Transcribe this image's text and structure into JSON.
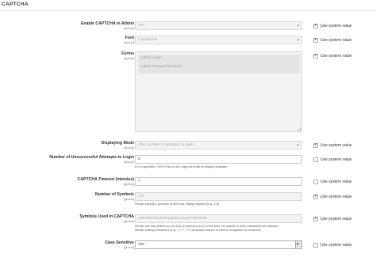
{
  "section": {
    "title": "CAPTCHA"
  },
  "fields": {
    "enable_admin": {
      "label": "Enable CAPTCHA in Admin",
      "scope": "[global]",
      "value": "Yes",
      "use_system": true
    },
    "font": {
      "label": "Font",
      "scope": "[global]",
      "value": "LinLibertine",
      "use_system": true
    },
    "forms": {
      "label": "Forms",
      "scope": "[global]",
      "options": [
        "Admin Login",
        "Admin Forgot Password"
      ],
      "use_system": true
    },
    "displaying_mode": {
      "label": "Displaying Mode",
      "scope": "[global]",
      "value": "After number of attempts to login",
      "use_system": true
    },
    "attempts": {
      "label": "Number of Unsuccessful Attempts to Login",
      "scope": "[global]",
      "value": "0",
      "note": "If 0 is specified, CAPTCHA on the Login form will be always available.",
      "use_system": false
    },
    "timeout": {
      "label": "CAPTCHA Timeout (minutes)",
      "scope": "[global]",
      "value": "7",
      "use_system": false
    },
    "symbols_count": {
      "label": "Number of Symbols",
      "scope": "[global]",
      "value": "4-5",
      "note": "Please specify 8 symbols at the most. Range allowed (e.g. 3-5)",
      "use_system": true
    },
    "symbols_used": {
      "label": "Symbols Used in CAPTCHA",
      "scope": "[global]",
      "value": "ABCDEFGHJKMnpqrstuvwxyz23456789",
      "note_1": "Please use only letters (a-z or A-Z) or numbers (0-9) in this field. No spaces or other characters are allowed.",
      "note_2": "Similar looking characters (e.g. \"i\", \"l\", \"1\") decrease chance of correct recognition by customer.",
      "use_system": true
    },
    "case_sensitive": {
      "label": "Case Sensitive",
      "scope": "[global]",
      "value": "Yes",
      "use_system": false
    }
  },
  "common": {
    "use_system_label": "Use system value"
  },
  "icons": {
    "select_arrow": "chevron-down-icon",
    "checkbox_mark": "check-icon"
  }
}
